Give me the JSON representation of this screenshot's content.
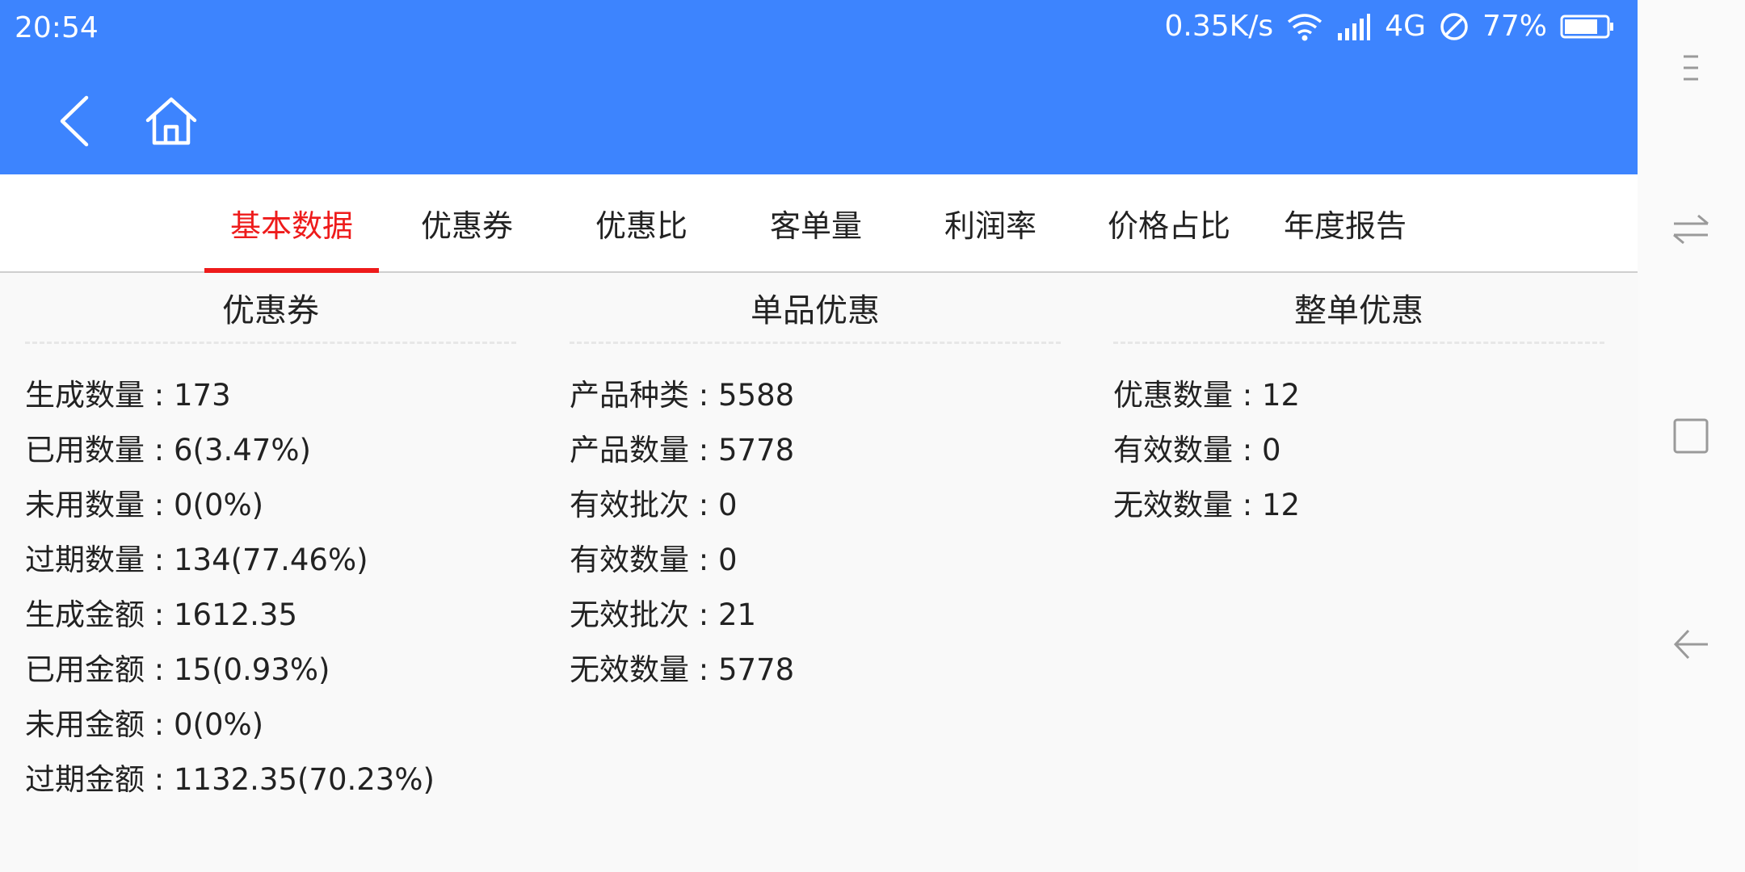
{
  "status_bar": {
    "time": "20:54",
    "speed": "0.35K/s",
    "network": "4G",
    "battery": "77%",
    "icons": [
      "wifi-icon",
      "signal-icon",
      "blocked-icon",
      "battery-icon"
    ]
  },
  "toolbar": {
    "icons": [
      "back-arrow-icon",
      "home-icon"
    ]
  },
  "tabs": [
    {
      "label": "基本数据",
      "active": true
    },
    {
      "label": "优惠券",
      "active": false
    },
    {
      "label": "优惠比",
      "active": false
    },
    {
      "label": "客单量",
      "active": false
    },
    {
      "label": "利润率",
      "active": false
    },
    {
      "label": "价格占比",
      "active": false
    },
    {
      "label": "年度报告",
      "active": false
    }
  ],
  "sections": [
    {
      "title": "优惠券",
      "rows": [
        "生成数量 : 173",
        "已用数量 : 6(3.47%)",
        "未用数量 : 0(0%)",
        "过期数量 : 134(77.46%)",
        "生成金额 : 1612.35",
        "已用金额 : 15(0.93%)",
        "未用金额 : 0(0%)",
        "过期金额 : 1132.35(70.23%)"
      ]
    },
    {
      "title": "单品优惠",
      "rows": [
        "产品种类 : 5588",
        "产品数量 : 5778",
        "有效批次 : 0",
        "有效数量 : 0",
        "无效批次 : 21",
        "无效数量 : 5778"
      ]
    },
    {
      "title": "整单优惠",
      "rows": [
        "优惠数量 : 12",
        "有效数量 : 0",
        "无效数量 : 12"
      ]
    }
  ],
  "system_nav": {
    "icons": [
      "menu-icon",
      "switch-icon",
      "recent-apps-icon",
      "back-icon"
    ]
  },
  "colors": {
    "header": "#3d84fe",
    "active_tab": "#ee1b1b"
  }
}
